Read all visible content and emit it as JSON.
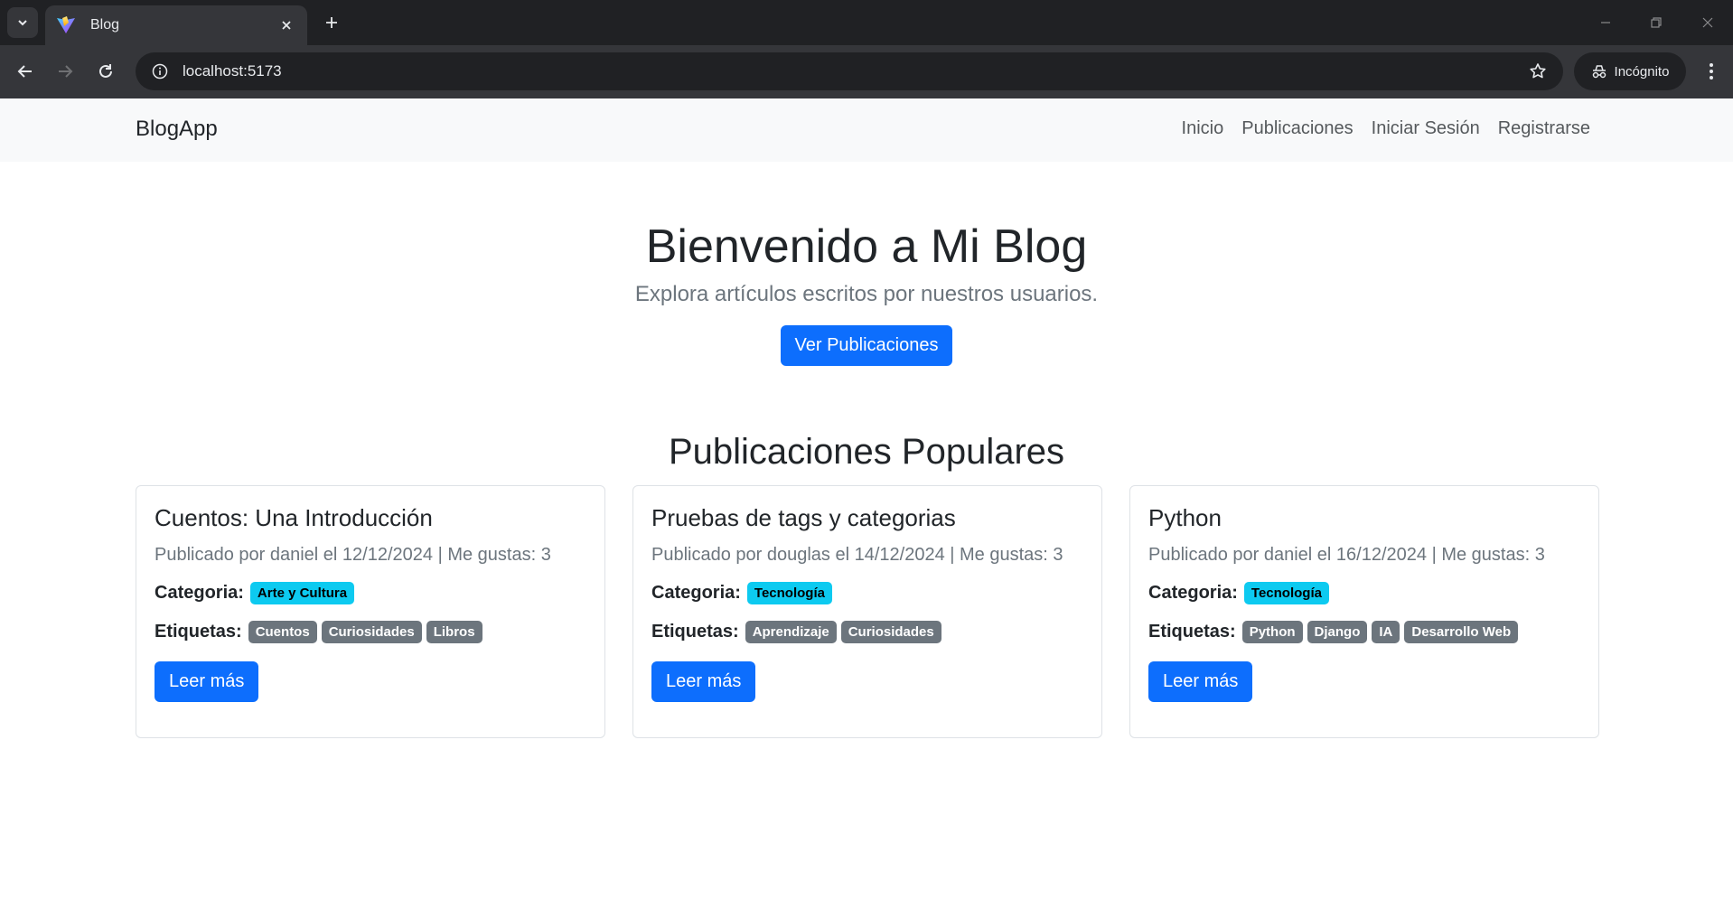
{
  "browser": {
    "tab_title": "Blog",
    "url": "localhost:5173",
    "incognito_label": "Incógnito"
  },
  "navbar": {
    "brand": "BlogApp",
    "links": [
      "Inicio",
      "Publicaciones",
      "Iniciar Sesión",
      "Registrarse"
    ]
  },
  "hero": {
    "title": "Bienvenido a Mi Blog",
    "subtitle": "Explora artículos escritos por nuestros usuarios.",
    "button": "Ver Publicaciones"
  },
  "popular": {
    "title": "Publicaciones Populares",
    "category_label": "Categoria:",
    "tags_label": "Etiquetas:",
    "read_more": "Leer más",
    "posts": [
      {
        "title": "Cuentos: Una Introducción",
        "meta": "Publicado por daniel el 12/12/2024 | Me gustas: 3",
        "category": "Arte y Cultura",
        "tags": [
          "Cuentos",
          "Curiosidades",
          "Libros"
        ]
      },
      {
        "title": "Pruebas de tags y categorias",
        "meta": "Publicado por douglas el 14/12/2024 | Me gustas: 3",
        "category": "Tecnología",
        "tags": [
          "Aprendizaje",
          "Curiosidades"
        ]
      },
      {
        "title": "Python",
        "meta": "Publicado por daniel el 16/12/2024 | Me gustas: 3",
        "category": "Tecnología",
        "tags": [
          "Python",
          "Django",
          "IA",
          "Desarrollo Web"
        ]
      }
    ]
  },
  "colors": {
    "primary": "#0d6efd",
    "info_badge": "#0dcaf0",
    "secondary_badge": "#6c757d"
  }
}
